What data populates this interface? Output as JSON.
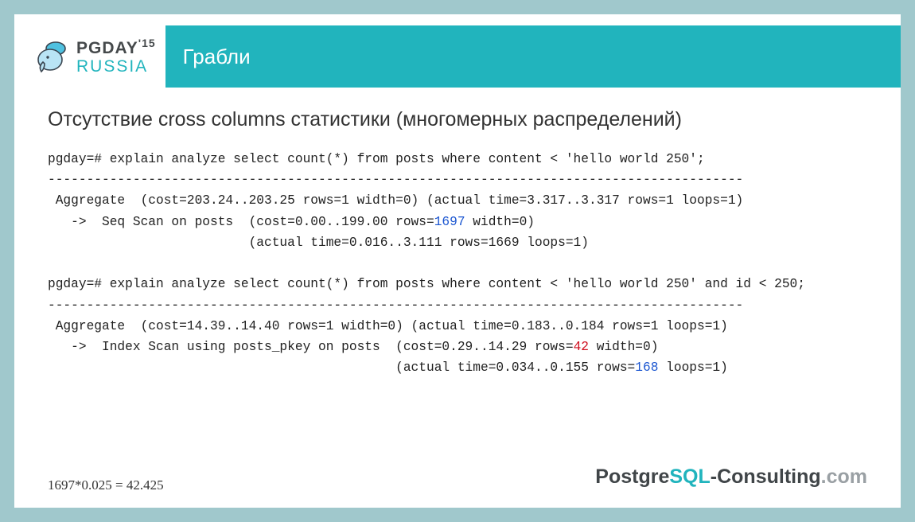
{
  "logo": {
    "line1a": "PGDAY",
    "line1b": "'15",
    "line2": "RUSSIA"
  },
  "titlebar": "Грабли",
  "heading": "Отсутствие cross columns статистики (многомерных распределений)",
  "code": {
    "q1_line": "pgday=# explain analyze select count(*) from posts where content < 'hello world 250';",
    "dash1": "------------------------------------------------------------------------------------------",
    "agg1": " Aggregate  (cost=203.24..203.25 rows=1 width=0) (actual time=3.317..3.317 rows=1 loops=1)",
    "seq1a": "   ->  Seq Scan on posts  (cost=0.00..199.00 rows=",
    "seq1_hl": "1697",
    "seq1b": " width=0)",
    "seq1_act": "                          (actual time=0.016..3.111 rows=1669 loops=1)",
    "q2_line": "pgday=# explain analyze select count(*) from posts where content < 'hello world 250' and id < 250;",
    "dash2": "------------------------------------------------------------------------------------------",
    "agg2": " Aggregate  (cost=14.39..14.40 rows=1 width=0) (actual time=0.183..0.184 rows=1 loops=1)",
    "idx2a": "   ->  Index Scan using posts_pkey on posts  (cost=0.29..14.29 rows=",
    "idx2_hl": "42",
    "idx2b": " width=0)",
    "idx2_act_a": "                                             (actual time=0.034..0.155 rows=",
    "idx2_act_hl": "168",
    "idx2_act_b": " loops=1)"
  },
  "footnote": "1697*0.025 = 42.425",
  "footer": {
    "p1": "Postgre",
    "p2": "SQL",
    "p3": "-Consulting",
    "p4": ".com"
  }
}
